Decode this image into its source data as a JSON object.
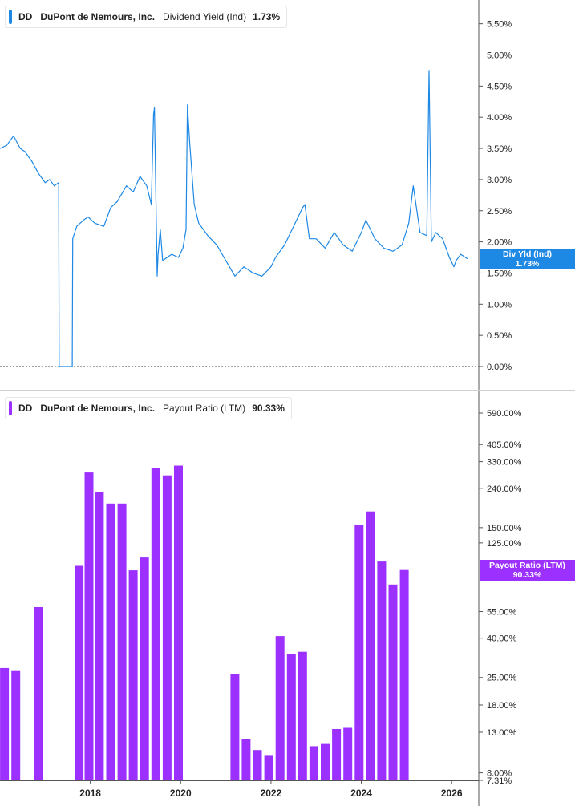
{
  "legend_top": {
    "ticker": "DD",
    "company": "DuPont de Nemours, Inc.",
    "metric": "Dividend Yield (Ind)",
    "value": "1.73%",
    "color": "#1e88e5"
  },
  "legend_bottom": {
    "ticker": "DD",
    "company": "DuPont de Nemours, Inc.",
    "metric": "Payout Ratio (LTM)",
    "value": "90.33%",
    "color": "#9b30ff"
  },
  "badge_top": {
    "label": "Div Yld (Ind)",
    "value": "1.73%"
  },
  "badge_bottom": {
    "label": "Payout Ratio (LTM)",
    "value": "90.33%"
  },
  "chart_data": [
    {
      "type": "line",
      "series": [
        {
          "name": "Dividend Yield (Ind)",
          "color": "#1e88e5"
        }
      ],
      "x_range": [
        2016.0,
        2026.6
      ],
      "ylim": [
        -0.0,
        6.0
      ],
      "yticks": [
        "5.50%",
        "5.00%",
        "4.50%",
        "4.00%",
        "3.50%",
        "3.00%",
        "2.50%",
        "2.00%",
        "1.50%",
        "1.00%",
        "0.50%",
        "0.00%"
      ],
      "ytick_values": [
        5.5,
        5.0,
        4.5,
        4.0,
        3.5,
        3.0,
        2.5,
        2.0,
        1.5,
        1.0,
        0.5,
        0.0
      ],
      "x": [
        2016.0,
        2016.15,
        2016.3,
        2016.45,
        2016.55,
        2016.7,
        2016.85,
        2017.0,
        2017.1,
        2017.2,
        2017.3,
        2017.31,
        2017.6,
        2017.61,
        2017.7,
        2017.85,
        2017.95,
        2018.1,
        2018.3,
        2018.45,
        2018.6,
        2018.8,
        2018.95,
        2019.1,
        2019.25,
        2019.35,
        2019.4,
        2019.42,
        2019.48,
        2019.5,
        2019.55,
        2019.6,
        2019.8,
        2019.95,
        2020.05,
        2020.12,
        2020.15,
        2020.2,
        2020.3,
        2020.4,
        2020.6,
        2020.8,
        2021.0,
        2021.2,
        2021.4,
        2021.6,
        2021.8,
        2022.0,
        2022.1,
        2022.3,
        2022.5,
        2022.7,
        2022.75,
        2022.85,
        2023.0,
        2023.2,
        2023.4,
        2023.6,
        2023.8,
        2024.0,
        2024.1,
        2024.3,
        2024.5,
        2024.7,
        2024.9,
        2025.05,
        2025.15,
        2025.3,
        2025.45,
        2025.5,
        2025.55,
        2025.65,
        2025.8,
        2025.95,
        2026.05,
        2026.1,
        2026.2,
        2026.35
      ],
      "y": [
        3.5,
        3.55,
        3.7,
        3.5,
        3.45,
        3.3,
        3.1,
        2.95,
        3.0,
        2.9,
        2.95,
        0.0,
        0.0,
        2.05,
        2.25,
        2.35,
        2.4,
        2.3,
        2.25,
        2.55,
        2.65,
        2.9,
        2.8,
        3.05,
        2.9,
        2.6,
        4.05,
        4.15,
        1.45,
        1.8,
        2.2,
        1.7,
        1.8,
        1.75,
        1.9,
        2.2,
        4.2,
        3.6,
        2.6,
        2.3,
        2.1,
        1.95,
        1.7,
        1.45,
        1.6,
        1.5,
        1.45,
        1.6,
        1.75,
        1.95,
        2.25,
        2.55,
        2.6,
        2.05,
        2.05,
        1.9,
        2.15,
        1.95,
        1.85,
        2.15,
        2.35,
        2.05,
        1.9,
        1.85,
        1.95,
        2.3,
        2.9,
        2.15,
        2.1,
        4.75,
        2.0,
        2.15,
        2.05,
        1.75,
        1.6,
        1.7,
        1.8,
        1.73
      ]
    },
    {
      "type": "bar",
      "series": [
        {
          "name": "Payout Ratio (LTM)",
          "color": "#9b30ff"
        }
      ],
      "x_range": [
        2016.0,
        2026.6
      ],
      "yscale": "log",
      "ylim": [
        7.31,
        800
      ],
      "yticks": [
        "590.00%",
        "405.00%",
        "330.00%",
        "240.00%",
        "150.00%",
        "125.00%",
        "55.00%",
        "40.00%",
        "25.00%",
        "18.00%",
        "13.00%",
        "8.00%",
        "7.31%"
      ],
      "ytick_values": [
        590,
        405,
        330,
        240,
        150,
        125,
        55,
        40,
        25,
        18,
        13,
        8,
        7.31
      ],
      "x": [
        2015.9,
        2016.1,
        2016.35,
        2016.85,
        2017.75,
        2017.97,
        2018.2,
        2018.45,
        2018.7,
        2018.95,
        2019.2,
        2019.45,
        2019.7,
        2019.95,
        2021.2,
        2021.45,
        2021.7,
        2021.95,
        2022.2,
        2022.45,
        2022.7,
        2022.95,
        2023.2,
        2023.45,
        2023.7,
        2023.95,
        2024.2,
        2024.45,
        2024.7,
        2024.95
      ],
      "values": [
        35,
        28,
        27,
        58,
        95,
        290,
        230,
        200,
        200,
        90,
        105,
        305,
        280,
        315,
        26,
        12,
        10.5,
        9.8,
        41,
        33,
        34,
        11,
        11.3,
        13.5,
        13.7,
        155,
        182,
        100,
        76,
        90.33
      ]
    }
  ],
  "x_labels": {
    "ticks": [
      "2018",
      "2020",
      "2022",
      "2024",
      "2026"
    ],
    "values": [
      2018,
      2020,
      2022,
      2024,
      2026
    ]
  },
  "colors": {
    "axis": "#555555",
    "tick_label": "#222222",
    "zero_line": "#444444",
    "panel_divider": "#cfcfcf"
  }
}
